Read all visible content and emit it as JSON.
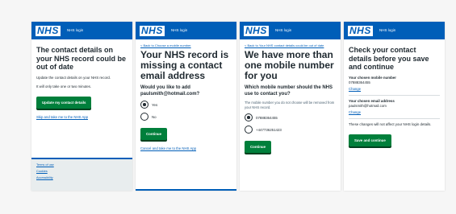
{
  "colors": {
    "nhs_blue": "#005eb8",
    "button_green": "#007f3b",
    "page_bg": "#f6f6f6",
    "footer_bg": "#e8edee"
  },
  "brand": {
    "logo_text": "NHS",
    "service_name": "NHS login"
  },
  "screen1": {
    "title": "The contact details on your NHS record could be out of date",
    "body1": "Update the contact details on your NHS record.",
    "body2": "It will only take one or two minutes.",
    "button": "Update my contact details",
    "skip_link": "Skip and take me to the NHS App",
    "footer_links": [
      "Terms of use",
      "Cookies",
      "Accessibility"
    ]
  },
  "screen2": {
    "back_link": "< Back to Choose a mobile number",
    "title": "Your NHS record is missing a contact email address",
    "question": "Would you like to add paulsmith@hotmail.com?",
    "options": [
      "Yes",
      "No"
    ],
    "selected": "Yes",
    "button": "Continue",
    "cancel_link": "Cancel and take me to the NHS App"
  },
  "screen3": {
    "back_link": "< Back to Your NHS contact details could be out of date",
    "title": "We have more than one mobile number for you",
    "question": "Which mobile number should the NHS use to contact you?",
    "hint": "The mobile number you do not choose will be removed from your NHS record.",
    "options": [
      "07888364455",
      "+447736251423"
    ],
    "selected": "07888364455",
    "button": "Continue"
  },
  "screen4": {
    "title": "Check your contact details before you save and continue",
    "mobile_label": "Your chosen mobile number",
    "mobile_value": "07888364455",
    "change1": "Change",
    "email_label": "Your chosen email address",
    "email_value": "paulsmith@hotmail.com",
    "change2": "Change",
    "note": "These changes will not affect your NHS login details.",
    "button": "Save and continue"
  }
}
